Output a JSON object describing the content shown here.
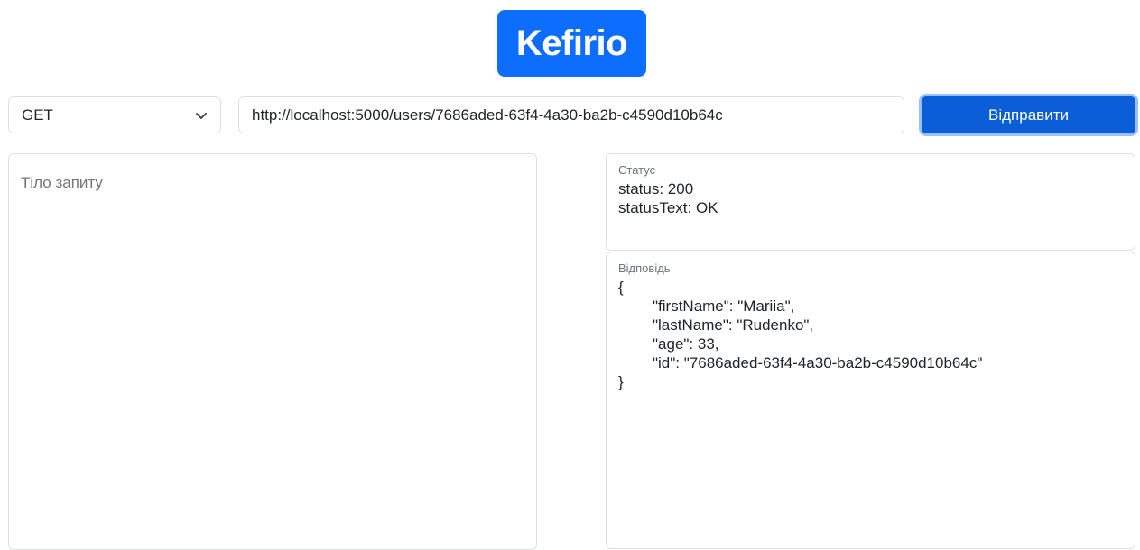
{
  "app": {
    "logo_text": "Kefirio",
    "brand_color": "#0d6efd"
  },
  "request": {
    "method": "GET",
    "url": "http://localhost:5000/users/7686aded-63f4-4a30-ba2b-c4590d10b64c",
    "send_label": "Відправити",
    "body_placeholder": "Тіло запиту"
  },
  "status_panel": {
    "label": "Статус",
    "status_line": "status: 200",
    "status_text_line": "statusText: OK"
  },
  "response_panel": {
    "label": "Відповідь",
    "open_brace": "{",
    "lines": [
      "\"firstName\": \"Mariia\",",
      "\"lastName\": \"Rudenko\",",
      "\"age\": 33,",
      "\"id\": \"7686aded-63f4-4a30-ba2b-c4590d10b64c\""
    ],
    "close_brace": "}"
  },
  "icons": {
    "method_dropdown": "chevron-down-icon"
  }
}
